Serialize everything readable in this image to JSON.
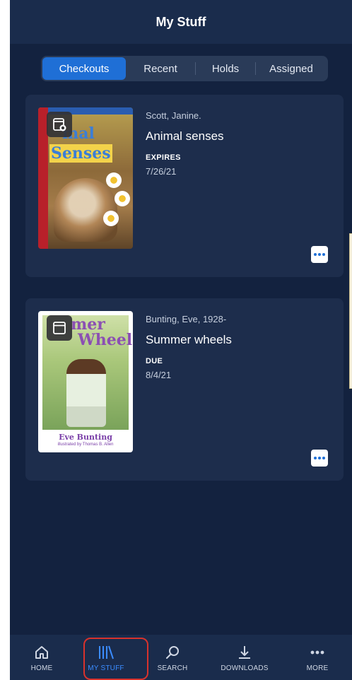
{
  "header": {
    "title": "My Stuff"
  },
  "tabs": [
    {
      "label": "Checkouts",
      "active": true
    },
    {
      "label": "Recent",
      "active": false
    },
    {
      "label": "Holds",
      "active": false
    },
    {
      "label": "Assigned",
      "active": false
    }
  ],
  "items": [
    {
      "author": "Scott, Janine.",
      "title": "Animal senses",
      "status_label": "EXPIRES",
      "date": "7/26/21",
      "cover": {
        "line1": "mal",
        "line2": "Senses"
      },
      "format_icon": "ebook-icon"
    },
    {
      "author": "Bunting, Eve, 1928-",
      "title": "Summer wheels",
      "status_label": "DUE",
      "date": "8/4/21",
      "cover": {
        "line1": "mer",
        "line2": "Wheels",
        "author": "Eve Bunting",
        "illustrator": "illustrated by Thomas B. Allen"
      },
      "format_icon": "book-icon"
    }
  ],
  "nav": [
    {
      "label": "HOME",
      "icon": "home-icon",
      "active": false
    },
    {
      "label": "MY STUFF",
      "icon": "library-icon",
      "active": true
    },
    {
      "label": "SEARCH",
      "icon": "search-icon",
      "active": false
    },
    {
      "label": "DOWNLOADS",
      "icon": "download-icon",
      "active": false
    },
    {
      "label": "MORE",
      "icon": "more-icon",
      "active": false
    }
  ],
  "colors": {
    "background": "#13223f",
    "card": "#1d2d4c",
    "accent": "#1f6fd6",
    "highlight_box": "#d8322c"
  }
}
